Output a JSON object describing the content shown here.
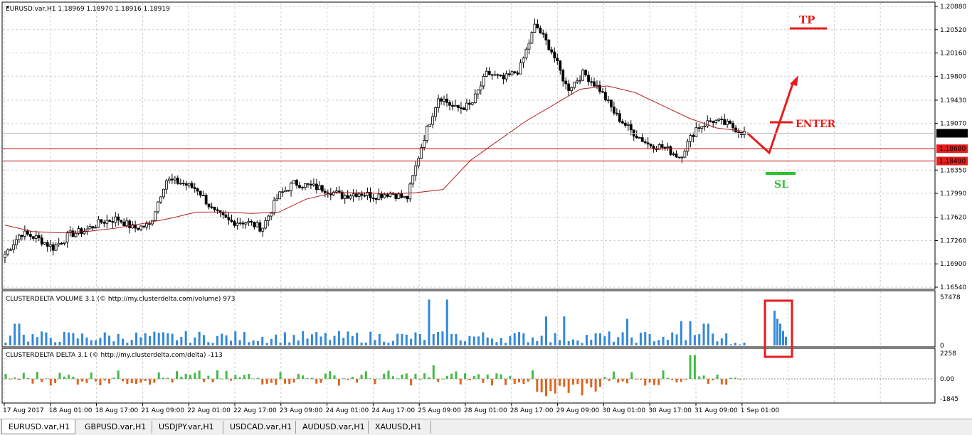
{
  "window": {
    "symbol_header": "EURUSD.var,H1  1.18969 1.18970 1.18916 1.18919"
  },
  "tabs": [
    {
      "label": "EURUSD.var,H1",
      "active": true
    },
    {
      "label": "GBPUSD.var,H1",
      "active": false
    },
    {
      "label": "USDJPY.var,H1",
      "active": false
    },
    {
      "label": "USDCAD.var,H1",
      "active": false
    },
    {
      "label": "AUDUSD.var,H1",
      "active": false
    },
    {
      "label": "XAUUSD,H1",
      "active": false
    }
  ],
  "colors": {
    "bull_bear_candle": "#000000",
    "moving_average": "#b02020",
    "level_line": "#c00000",
    "volume_bar": "#3388d8",
    "delta_positive": "#44bb44",
    "delta_negative": "#dd6622",
    "annotation_red": "#e81c1c",
    "annotation_green": "#2ec02e",
    "price_label_bg": "#e81c1c",
    "current_price_bg": "#000000"
  },
  "chart_data": [
    {
      "type": "candlestick",
      "title": "EURUSD.var,H1  1.18969 1.18970 1.18916 1.18919",
      "ylim": [
        1.1654,
        1.2088
      ],
      "y_ticks": [
        "1.20880",
        "1.20520",
        "1.20160",
        "1.19800",
        "1.19430",
        "1.19070",
        "1.18350",
        "1.17990",
        "1.17620",
        "1.17260",
        "1.16900",
        "1.16540"
      ],
      "x_ticks": [
        "17 Aug 2017",
        "18 Aug 01:00",
        "18 Aug 17:00",
        "21 Aug 09:00",
        "22 Aug 01:00",
        "22 Aug 17:00",
        "23 Aug 09:00",
        "24 Aug 01:00",
        "24 Aug 17:00",
        "25 Aug 09:00",
        "28 Aug 01:00",
        "28 Aug 17:00",
        "29 Aug 09:00",
        "30 Aug 01:00",
        "30 Aug 17:00",
        "31 Aug 09:00",
        "1 Sep 01:00"
      ],
      "close_anchors": [
        1.1705,
        1.1738,
        1.173,
        1.1715,
        1.1735,
        1.1742,
        1.1755,
        1.176,
        1.1745,
        1.175,
        1.182,
        1.1815,
        1.1805,
        1.177,
        1.1755,
        1.1755,
        1.1745,
        1.1795,
        1.1815,
        1.181,
        1.1805,
        1.1795,
        1.18,
        1.1795,
        1.18,
        1.179,
        1.188,
        1.195,
        1.193,
        1.1935,
        1.1985,
        1.1975,
        1.199,
        1.206,
        1.202,
        1.196,
        1.1985,
        1.196,
        1.192,
        1.1895,
        1.1875,
        1.187,
        1.1855,
        1.19,
        1.1912,
        1.1905,
        1.1892
      ],
      "moving_average": [
        1.175,
        1.174,
        1.1738,
        1.174,
        1.1745,
        1.1752,
        1.176,
        1.177,
        1.177,
        1.1768,
        1.177,
        1.179,
        1.18,
        1.18,
        1.1798,
        1.18,
        1.1805,
        1.185,
        1.188,
        1.191,
        1.1935,
        1.196,
        1.1965,
        1.1955,
        1.1935,
        1.1915,
        1.19,
        1.1895
      ],
      "current_price": "1.18919",
      "levels": [
        {
          "name": "resistance",
          "label": "1.18680",
          "value": 1.1868
        },
        {
          "name": "support",
          "label": "1.18490",
          "value": 1.1849
        }
      ],
      "annotations": {
        "tp": "TP",
        "enter": "ENTER",
        "sl": "SL"
      }
    },
    {
      "type": "bar",
      "title": "CLUSTERDELTA VOLUME 3.1 (© http://my.clusterdelta.com/volume) 973",
      "ylim": [
        0,
        57478
      ],
      "y_ticks": [
        "57478",
        "0"
      ]
    },
    {
      "type": "bar",
      "title": "CLUSTERDELTA DELTA 3.1 (© http://my.clusterdelta.com/delta) -113",
      "ylim": [
        -1845,
        2258
      ],
      "y_ticks": [
        "2258",
        "0.00",
        "-1845"
      ]
    }
  ]
}
